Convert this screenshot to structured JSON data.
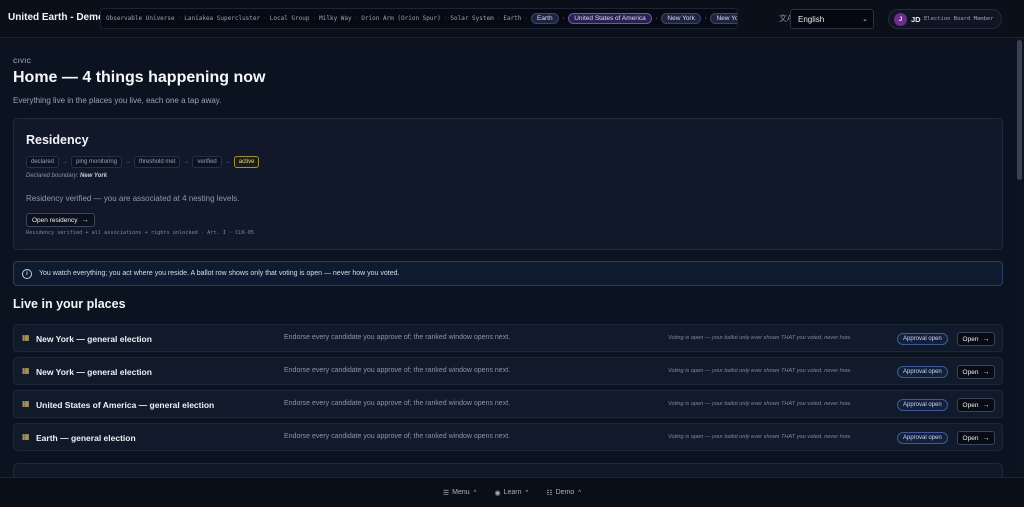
{
  "header": {
    "app_title": "United Earth - Demo",
    "breadcrumb": {
      "mono_items": [
        "Observable Universe",
        "Laniakea Supercluster",
        "Local Group",
        "Milky Way",
        "Orion Arm (Orion Spur)",
        "Solar System",
        "Earth"
      ],
      "pills": [
        "Earth",
        "United States of America",
        "New York",
        "New York"
      ]
    },
    "language": "English",
    "user": {
      "avatar_letter": "J",
      "initials": "JD",
      "role": "Election Board Member"
    }
  },
  "main": {
    "kicker": "CIVIC",
    "title": "Home — 4 things happening now",
    "subtitle": "Everything live in the places you live, each one a tap away."
  },
  "residency": {
    "title": "Residency",
    "steps": [
      "declared",
      "ping monitoring",
      "threshold met",
      "verified",
      "active"
    ],
    "boundary_label": "Declared boundary:",
    "boundary_value": "New York",
    "status": "Residency verified — you are associated at 4 nesting levels.",
    "open_button": "Open residency",
    "footnote": "Residency verified + all associations + rights unlocked · Art. I · CLK-05"
  },
  "banner": {
    "text": "You watch everything; you act where you reside. A ballot row shows only that voting is open — never how you voted."
  },
  "places": {
    "heading": "Live in your places",
    "rows": [
      {
        "name": "New York — general election",
        "description": "Endorse every candidate you approve of; the ranked window opens next.",
        "note": "Voting is open — your ballot only ever shows THAT you voted, never how.",
        "badge": "Approval open",
        "action": "Open"
      },
      {
        "name": "New York — general election",
        "description": "Endorse every candidate you approve of; the ranked window opens next.",
        "note": "Voting is open — your ballot only ever shows THAT you voted, never how.",
        "badge": "Approval open",
        "action": "Open"
      },
      {
        "name": "United States of America — general election",
        "description": "Endorse every candidate you approve of; the ranked window opens next.",
        "note": "Voting is open — your ballot only ever shows THAT you voted, never how.",
        "badge": "Approval open",
        "action": "Open"
      },
      {
        "name": "Earth — general election",
        "description": "Endorse every candidate you approve of; the ranked window opens next.",
        "note": "Voting is open — your ballot only ever shows THAT you voted, never how.",
        "badge": "Approval open",
        "action": "Open"
      }
    ]
  },
  "bottom_nav": {
    "items": [
      {
        "label": "Menu",
        "icon": "menu-icon"
      },
      {
        "label": "Learn",
        "icon": "eye-icon"
      },
      {
        "label": "Demo",
        "icon": "grid-icon"
      }
    ]
  },
  "colors": {
    "background": "#0b1220",
    "card": "#101829",
    "active_step": "#e9dc7c",
    "badge_border": "#3e5a92",
    "avatar": "#6b2f8a"
  }
}
